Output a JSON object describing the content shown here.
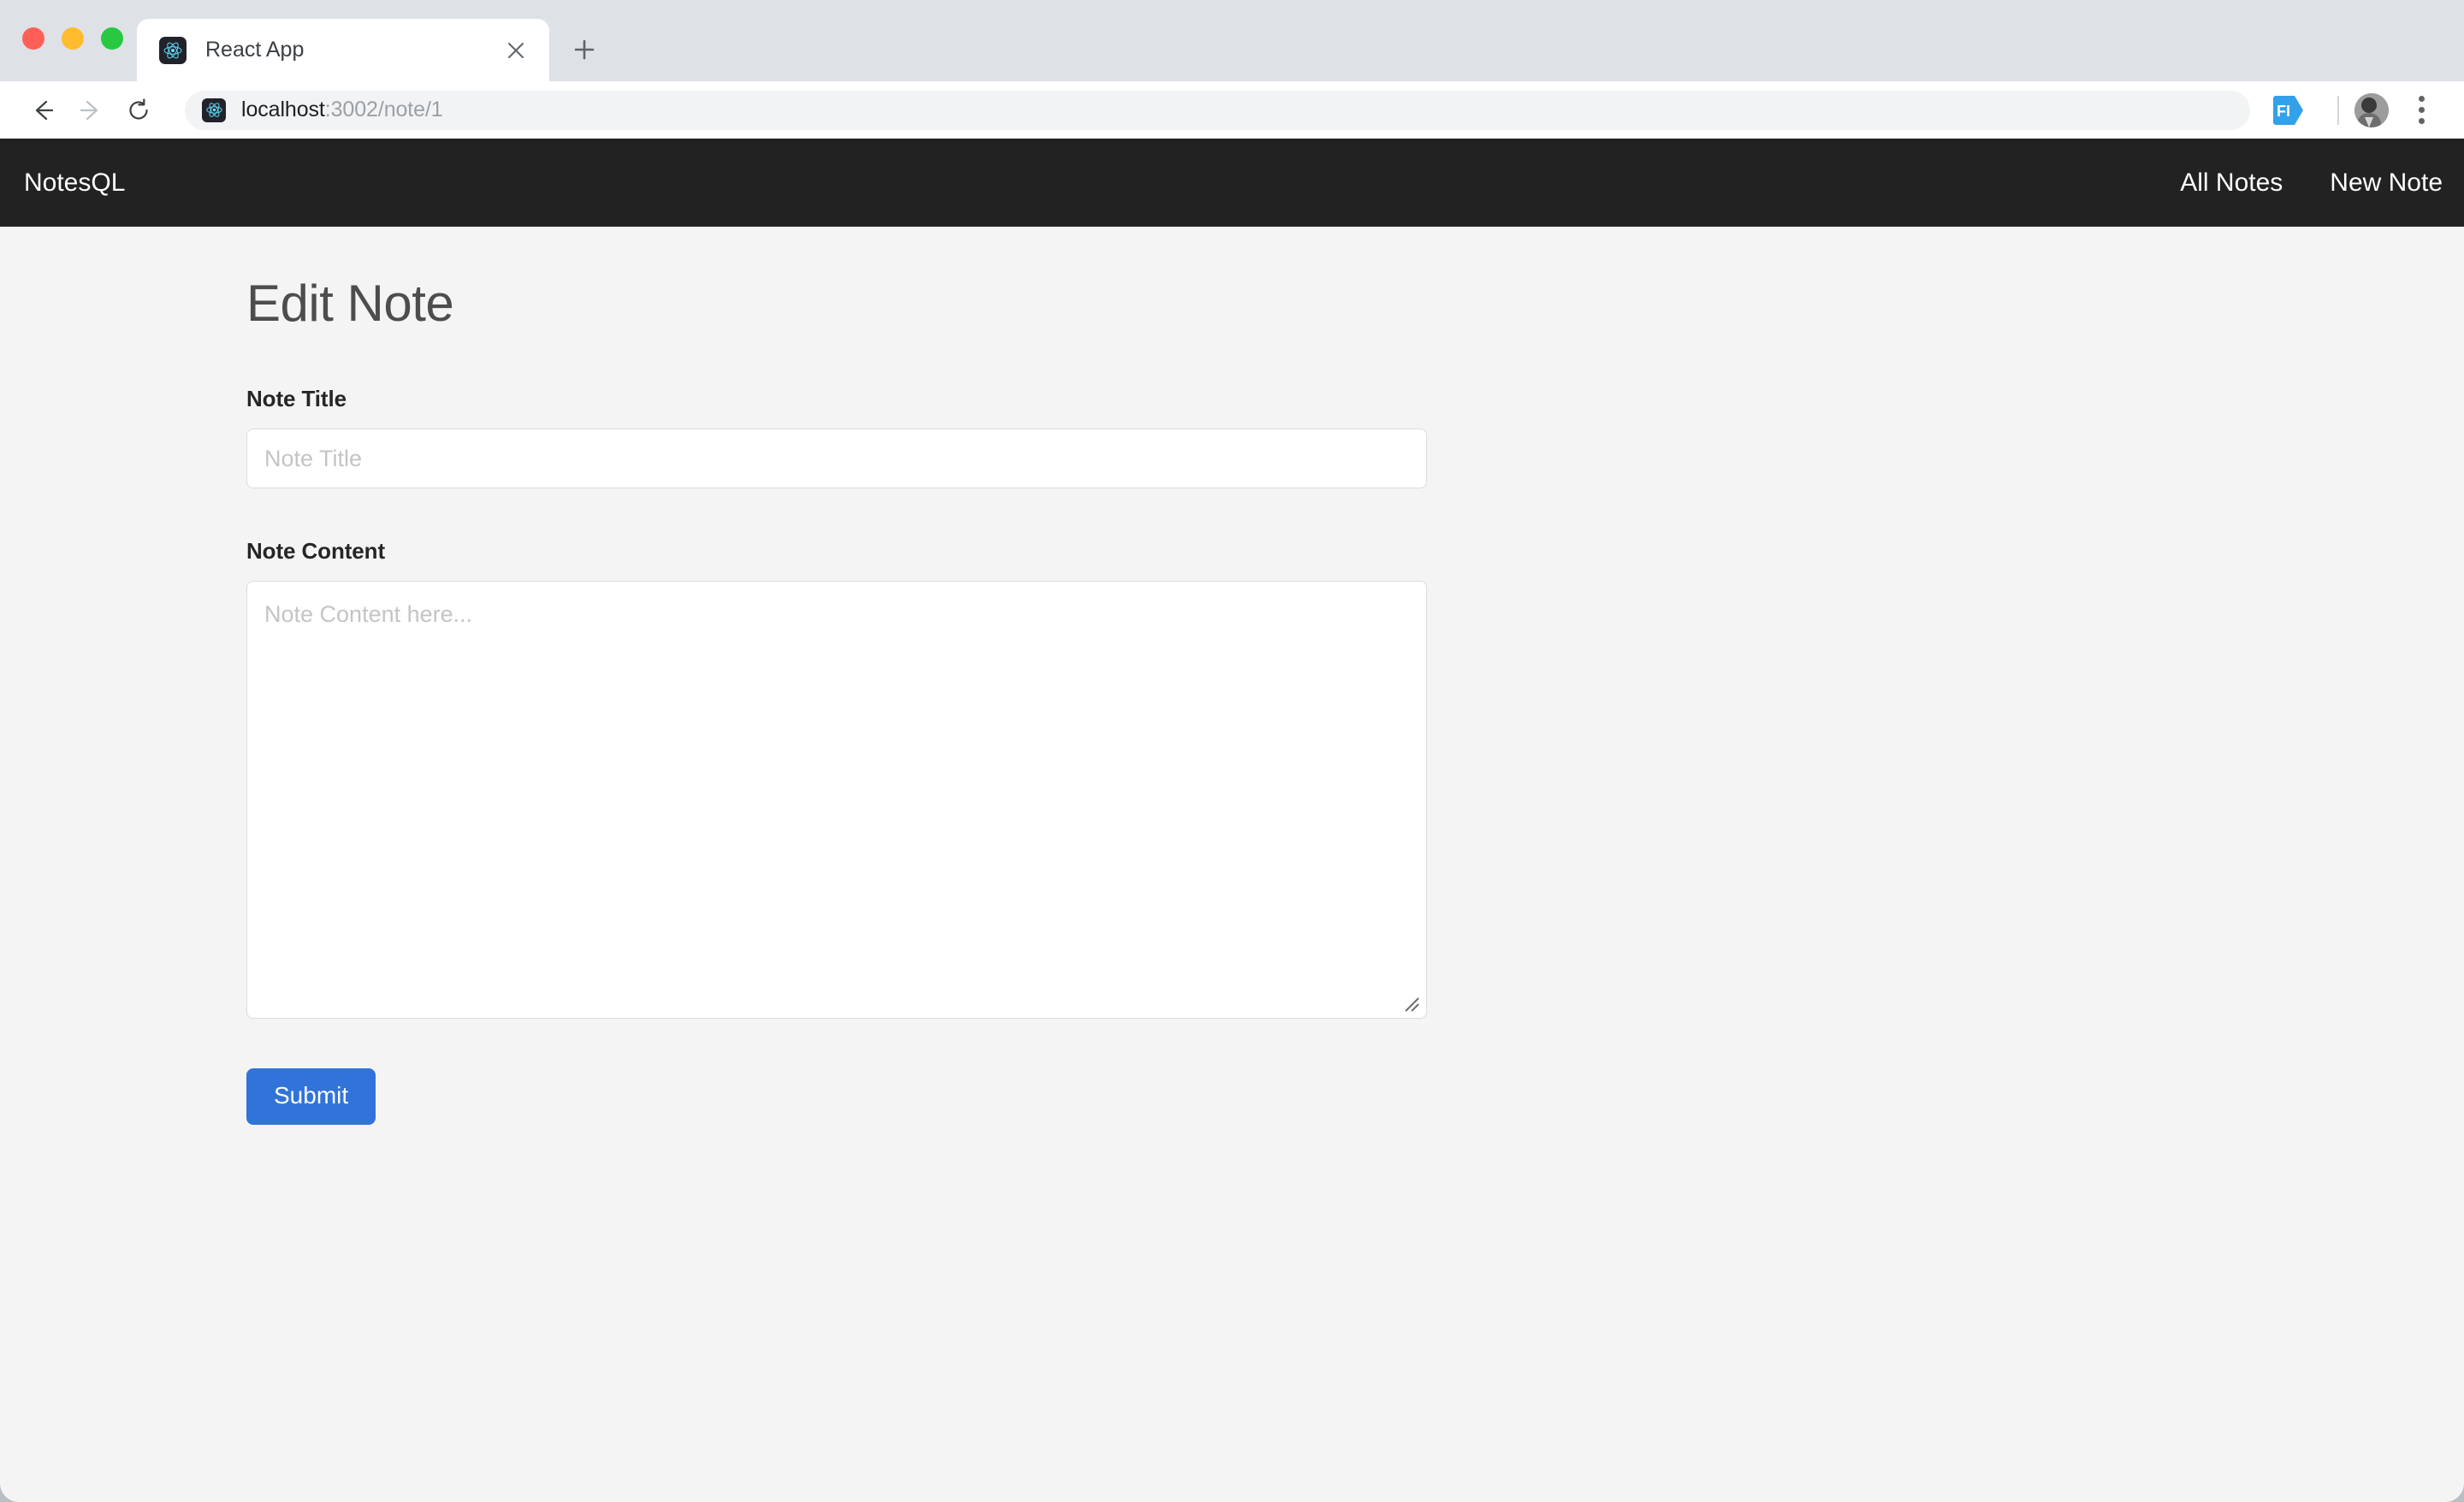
{
  "browser": {
    "window_controls": [
      {
        "name": "close",
        "color": "#ff5f57"
      },
      {
        "name": "minimize",
        "color": "#febc2e"
      },
      {
        "name": "maximize",
        "color": "#28c840"
      }
    ],
    "tab": {
      "title": "React App",
      "favicon": "react-logo-icon",
      "close_icon": "close-icon"
    },
    "new_tab_icon": "plus-icon",
    "toolbar": {
      "back_icon": "arrow-left-icon",
      "forward_icon": "arrow-right-icon",
      "reload_icon": "reload-icon",
      "omnibox": {
        "favicon": "react-logo-icon",
        "url_host": "localhost",
        "url_path": ":3002/note/1"
      },
      "extension_icon": "fi-extension-icon",
      "extension_label": "FI",
      "avatar_icon": "profile-avatar",
      "menu_icon": "three-dot-menu-icon"
    }
  },
  "navbar": {
    "brand": "NotesQL",
    "links": [
      {
        "label": "All Notes"
      },
      {
        "label": "New Note"
      }
    ]
  },
  "main": {
    "page_title": "Edit Note",
    "fields": [
      {
        "label": "Note Title",
        "placeholder": "Note Title",
        "value": ""
      },
      {
        "label": "Note Content",
        "placeholder": "Note Content here...",
        "value": ""
      }
    ],
    "submit_label": "Submit"
  },
  "colors": {
    "navbar_bg": "#222222",
    "page_bg": "#f4f4f4",
    "accent_blue": "#3173d9",
    "react_cyan": "#61dafb",
    "tabstrip_bg": "#dee1e6"
  }
}
